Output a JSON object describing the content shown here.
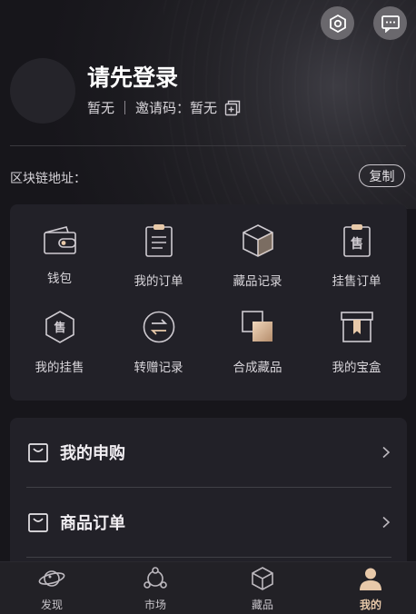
{
  "header": {
    "title": "请先登录",
    "nickname": "暂无",
    "invite_label": "邀请码：",
    "invite_value": "暂无",
    "settings_icon": "hexagon-settings-icon",
    "message_icon": "message-icon"
  },
  "chain": {
    "label": "区块链地址：",
    "copy_button": "复制"
  },
  "grid": {
    "items": [
      {
        "label": "钱包",
        "icon": "wallet-icon"
      },
      {
        "label": "我的订单",
        "icon": "order-icon"
      },
      {
        "label": "藏品记录",
        "icon": "collection-box-icon"
      },
      {
        "label": "挂售订单",
        "icon": "sale-order-icon"
      },
      {
        "label": "我的挂售",
        "icon": "sale-badge-icon"
      },
      {
        "label": "转赠记录",
        "icon": "transfer-icon"
      },
      {
        "label": "合成藏品",
        "icon": "synthesis-icon"
      },
      {
        "label": "我的宝盒",
        "icon": "treasure-box-icon"
      }
    ]
  },
  "list": {
    "items": [
      {
        "label": "我的申购",
        "icon": "bag-icon"
      },
      {
        "label": "商品订单",
        "icon": "bag-icon"
      }
    ]
  },
  "tabbar": {
    "items": [
      {
        "label": "发现",
        "icon": "planet-icon"
      },
      {
        "label": "市场",
        "icon": "market-icon"
      },
      {
        "label": "藏品",
        "icon": "cube-icon"
      },
      {
        "label": "我的",
        "icon": "user-icon"
      }
    ],
    "active_index": 3
  },
  "colors": {
    "accent": "#e8c9a9",
    "background": "#17161b",
    "card": "#222128"
  }
}
